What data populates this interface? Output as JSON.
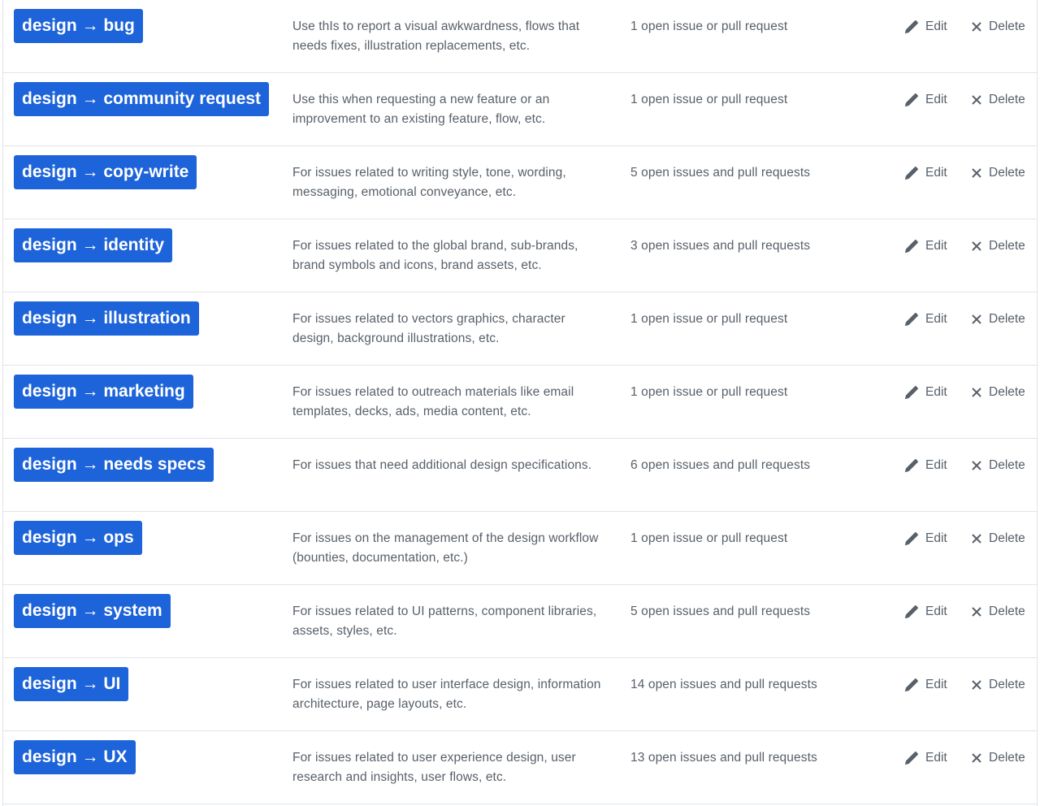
{
  "labels": [
    {
      "name": "design → bug",
      "description": "Use thIs to report a visual awkwardness, flows that needs fixes, illustration replacements, etc.",
      "count": "1 open issue or pull request",
      "edit": "Edit",
      "delete": "Delete"
    },
    {
      "name": "design → community request",
      "description": "Use this when requesting a new feature or an improvement to an existing feature, flow, etc.",
      "count": "1 open issue or pull request",
      "edit": "Edit",
      "delete": "Delete"
    },
    {
      "name": "design → copy-write",
      "description": "For issues related to writing style, tone, wording, messaging, emotional conveyance, etc.",
      "count": "5 open issues and pull requests",
      "edit": "Edit",
      "delete": "Delete"
    },
    {
      "name": "design → identity",
      "description": "For issues related to the global brand, sub-brands, brand symbols and icons, brand assets, etc.",
      "count": "3 open issues and pull requests",
      "edit": "Edit",
      "delete": "Delete"
    },
    {
      "name": "design → illustration",
      "description": "For issues related to vectors graphics, character design, background illustrations, etc.",
      "count": "1 open issue or pull request",
      "edit": "Edit",
      "delete": "Delete"
    },
    {
      "name": "design → marketing",
      "description": "For issues related to outreach materials like email templates, decks, ads, media content, etc.",
      "count": "1 open issue or pull request",
      "edit": "Edit",
      "delete": "Delete"
    },
    {
      "name": "design → needs specs",
      "description": "For issues that need additional design specifications.",
      "count": "6 open issues and pull requests",
      "edit": "Edit",
      "delete": "Delete"
    },
    {
      "name": "design → ops",
      "description": "For issues on the management of the design workflow (bounties, documentation, etc.)",
      "count": "1 open issue or pull request",
      "edit": "Edit",
      "delete": "Delete"
    },
    {
      "name": "design → system",
      "description": "For issues related to UI patterns, component libraries, assets, styles, etc.",
      "count": "5 open issues and pull requests",
      "edit": "Edit",
      "delete": "Delete"
    },
    {
      "name": "design → UI",
      "description": "For issues related to user interface design, information architecture, page layouts, etc.",
      "count": "14 open issues and pull requests",
      "edit": "Edit",
      "delete": "Delete"
    },
    {
      "name": "design → UX",
      "description": "For issues related to user experience design, user research and insights, user flows, etc.",
      "count": "13 open issues and pull requests",
      "edit": "Edit",
      "delete": "Delete"
    }
  ],
  "icons": {
    "edit": "pencil-icon",
    "delete": "x-icon"
  },
  "colors": {
    "label_bg": "#1d63d9",
    "label_text": "#ffffff",
    "muted_text": "#586069",
    "border": "#e1e4e8"
  }
}
